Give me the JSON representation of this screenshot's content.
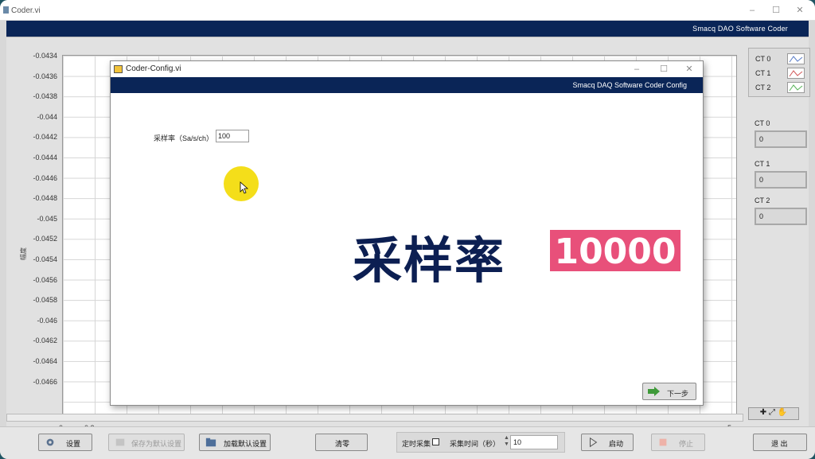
{
  "window": {
    "title": "Coder.vi"
  },
  "banner": {
    "text": "Smacq DAO Software Coder"
  },
  "chart_data": {
    "type": "line",
    "ylabel": "幅度",
    "yticks": [
      "-0.0434",
      "-0.0436",
      "-0.0438",
      "-0.044",
      "-0.0442",
      "-0.0444",
      "-0.0446",
      "-0.0448",
      "-0.045",
      "-0.0452",
      "-0.0454",
      "-0.0456",
      "-0.0458",
      "-0.046",
      "-0.0462",
      "-0.0464",
      "-0.0466"
    ],
    "xticks": [
      "0",
      "0.2",
      "5"
    ],
    "ylim": [
      -0.0466,
      -0.0434
    ],
    "grid": true,
    "series": []
  },
  "legend": {
    "items": [
      {
        "label": "CT 0",
        "color": "#5a7ec8"
      },
      {
        "label": "CT 1",
        "color": "#d25a5a"
      },
      {
        "label": "CT 2",
        "color": "#5ab45a"
      }
    ]
  },
  "channels": [
    {
      "label": "CT 0",
      "value": "0"
    },
    {
      "label": "CT 1",
      "value": "0"
    },
    {
      "label": "CT 2",
      "value": "0"
    }
  ],
  "bottom": {
    "settings": "设置",
    "save_default": "保存为默认设置",
    "load_default": "加载默认设置",
    "clear": "清零",
    "timed_acq": "定时采集",
    "acq_time_label": "采集时间（秒）",
    "acq_time_value": "10",
    "start": "启动",
    "stop": "停止",
    "exit": "退 出"
  },
  "dialog": {
    "title": "Coder-Config.vi",
    "banner": "Smacq DAQ Software Coder Config",
    "rate_label": "采样率（Sa/s/ch）",
    "rate_value": "100",
    "next": "下一步"
  },
  "caption": {
    "text": "采样率",
    "value": "10000"
  }
}
